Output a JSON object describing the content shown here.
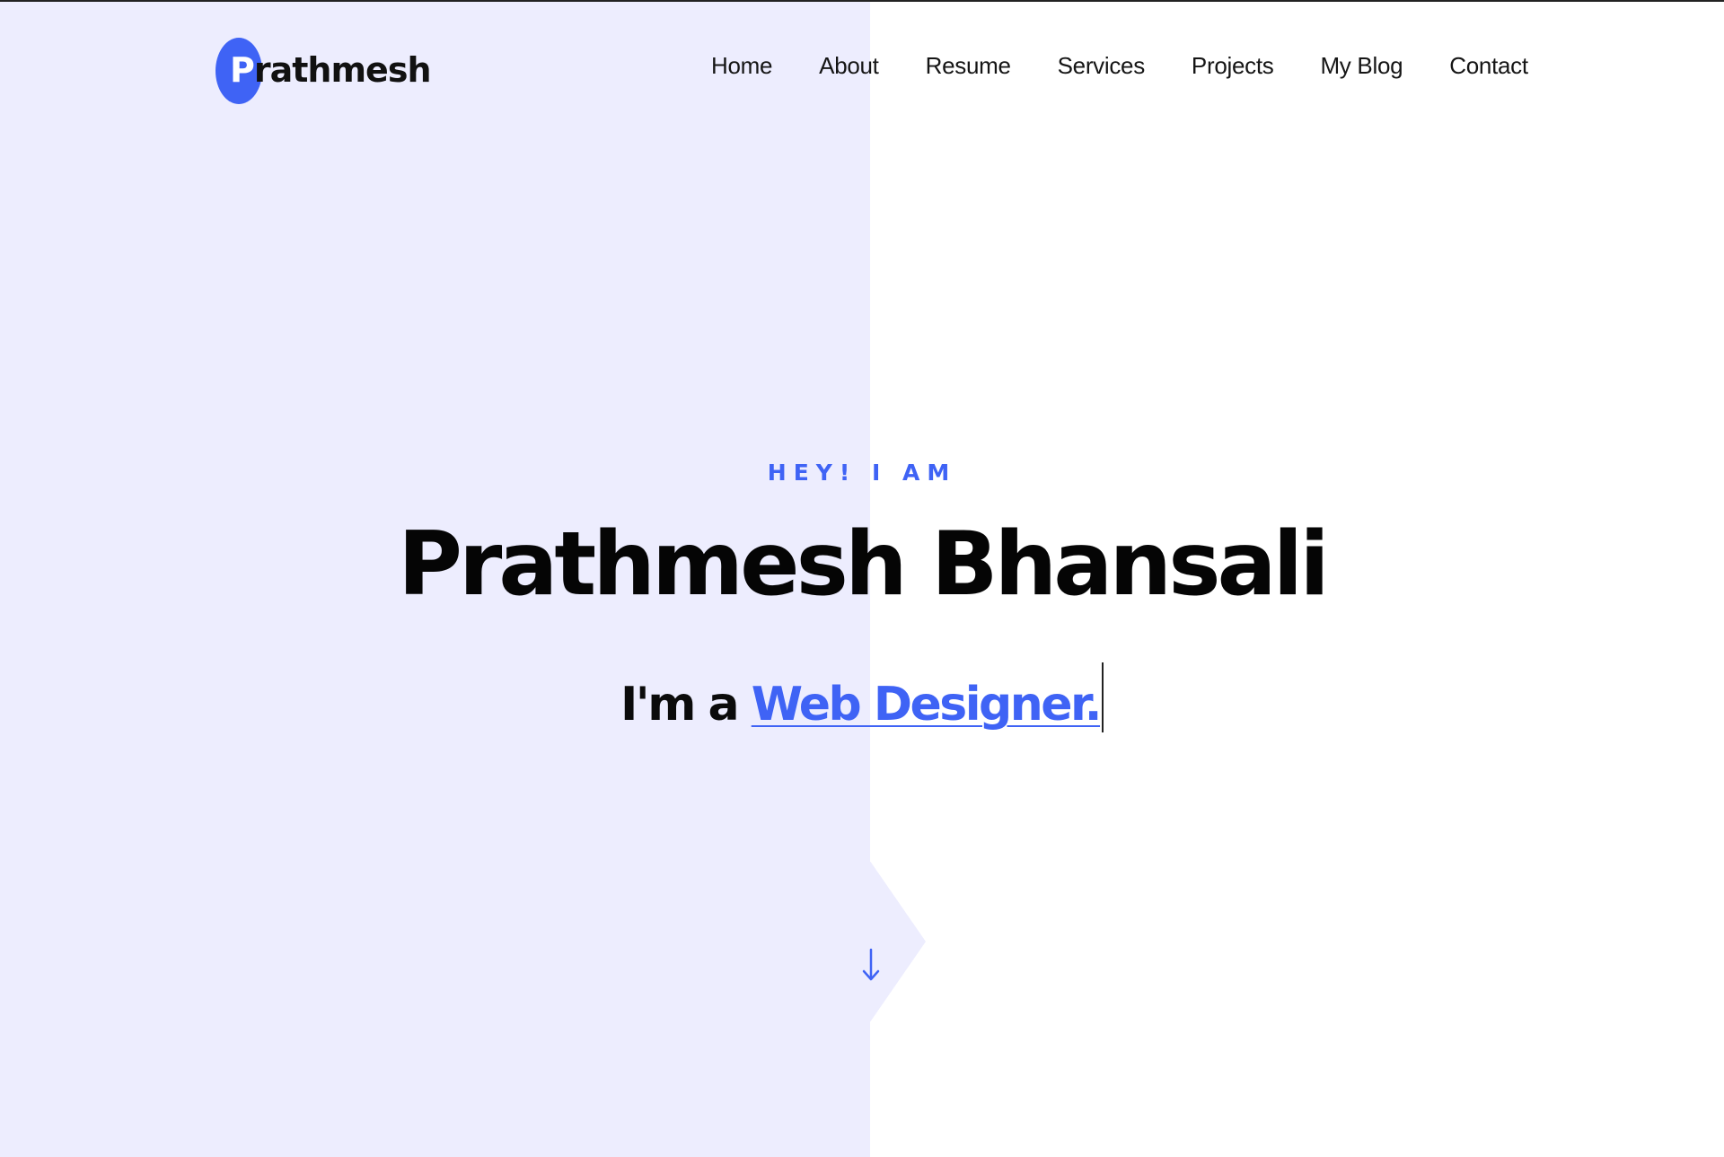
{
  "header": {
    "logo_initial": "P",
    "logo_rest": "rathmesh"
  },
  "nav": {
    "items": [
      "Home",
      "About",
      "Resume",
      "Services",
      "Projects",
      "My Blog",
      "Contact"
    ]
  },
  "hero": {
    "kicker": "HEY! I AM",
    "name": "Prathmesh Bhansali",
    "role_prefix": "I'm a",
    "role_highlight": "Web Designer."
  },
  "colors": {
    "accent": "#3f63f5",
    "panel": "#ededfe",
    "text": "#111111"
  },
  "icons": {
    "scroll": "arrow-down-icon"
  }
}
